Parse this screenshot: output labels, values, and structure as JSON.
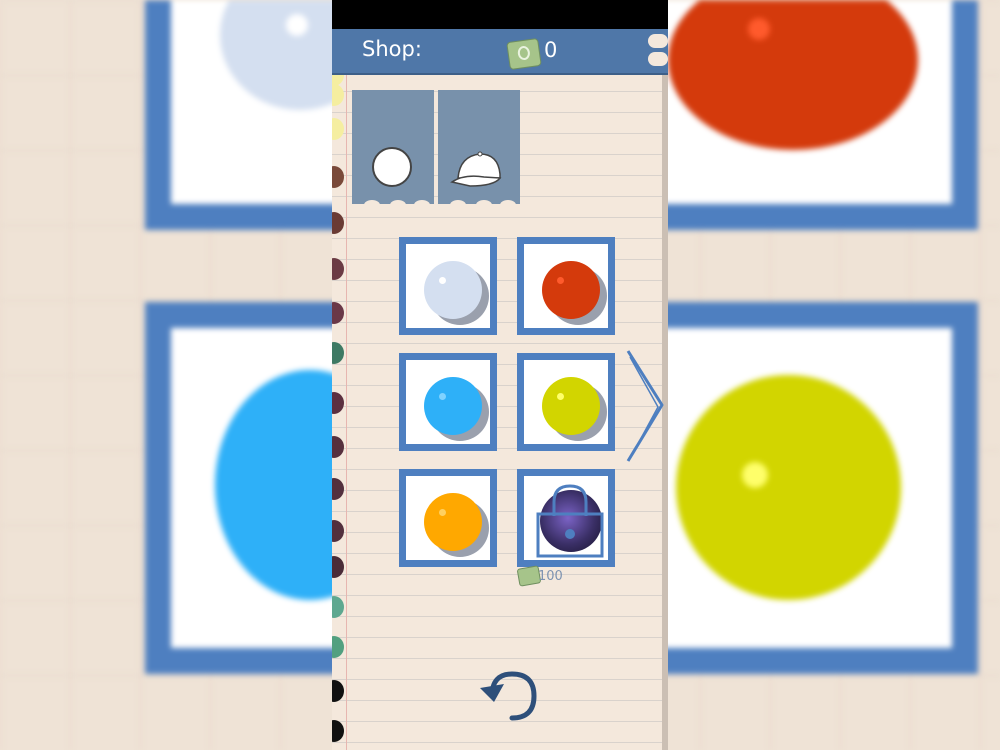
{
  "header": {
    "title": "Shop:",
    "currency_icon": "cash-icon",
    "balance": "0"
  },
  "tabs": [
    {
      "name": "balls",
      "icon": "ball-icon"
    },
    {
      "name": "hats",
      "icon": "cap-icon"
    }
  ],
  "items": [
    {
      "color": "#d4dff0",
      "locked": false
    },
    {
      "color": "#d43a0c",
      "locked": false
    },
    {
      "color": "#2eb0f8",
      "locked": false
    },
    {
      "color": "#d2d500",
      "locked": false
    },
    {
      "color": "#ffa800",
      "locked": false
    },
    {
      "color": "#3a2f66",
      "locked": true,
      "price": "100"
    }
  ],
  "colors": {
    "header": "#4f77a8",
    "frame": "#4e7fc0",
    "paper": "#f4e8dc"
  },
  "icons": {
    "next": "chevron-right-icon",
    "back": "undo-icon"
  }
}
